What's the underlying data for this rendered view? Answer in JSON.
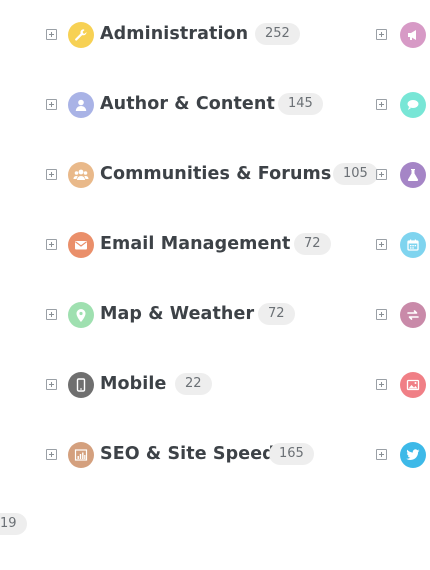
{
  "categories": [
    {
      "label": "Administration",
      "count": "252",
      "icon": "wrench-icon",
      "color": "#f7d154"
    },
    {
      "label": "Author & Content",
      "count": "145",
      "icon": "user-icon",
      "color": "#a9b3e6"
    },
    {
      "label": "Communities & Forums",
      "count": "105",
      "icon": "group-icon",
      "color": "#e9b98a"
    },
    {
      "label": "Email Management",
      "count": "72",
      "icon": "envelope-icon",
      "color": "#ea8f6a"
    },
    {
      "label": "Map & Weather",
      "count": "72",
      "icon": "map-pin-icon",
      "color": "#9fe0b0"
    },
    {
      "label": "Mobile",
      "count": "22",
      "icon": "phone-icon",
      "color": "#6f6f6f"
    },
    {
      "label": "SEO & Site Speed",
      "count": "165",
      "icon": "chart-icon",
      "color": "#d4a07e"
    }
  ],
  "right_column": [
    {
      "icon": "megaphone-icon",
      "color": "#d79ac6"
    },
    {
      "icon": "chat-bubble-icon",
      "color": "#78e6d6"
    },
    {
      "icon": "flask-icon",
      "color": "#a585c6"
    },
    {
      "icon": "calendar-icon",
      "color": "#7fd4ef"
    },
    {
      "icon": "arrows-exchange-icon",
      "color": "#c98aa9"
    },
    {
      "icon": "image-icon",
      "color": "#f07f86"
    },
    {
      "icon": "twitter-icon",
      "color": "#3db9e8"
    }
  ],
  "stray_badge": "19"
}
